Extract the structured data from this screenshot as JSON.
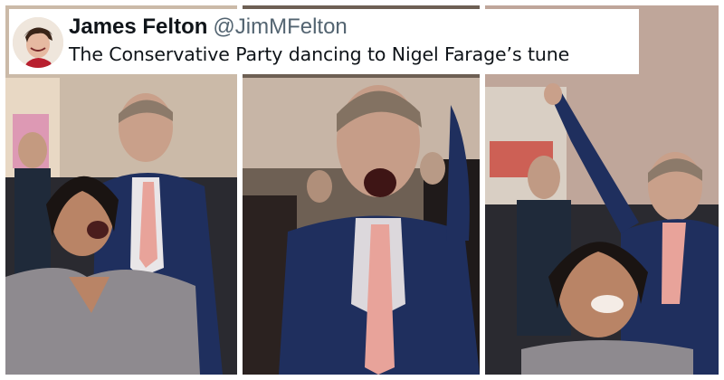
{
  "tweet": {
    "display_name": "James Felton",
    "handle": "@JimMFelton",
    "text": "The Conservative Party dancing to Nigel Farage’s tune"
  },
  "colors": {
    "name_text": "#0f1419",
    "handle_text": "#536471",
    "background": "#ffffff",
    "jacket_navy": "#1f2f5e",
    "tie_pink": "#e8a39a"
  },
  "icons": [
    "avatar-icon"
  ]
}
